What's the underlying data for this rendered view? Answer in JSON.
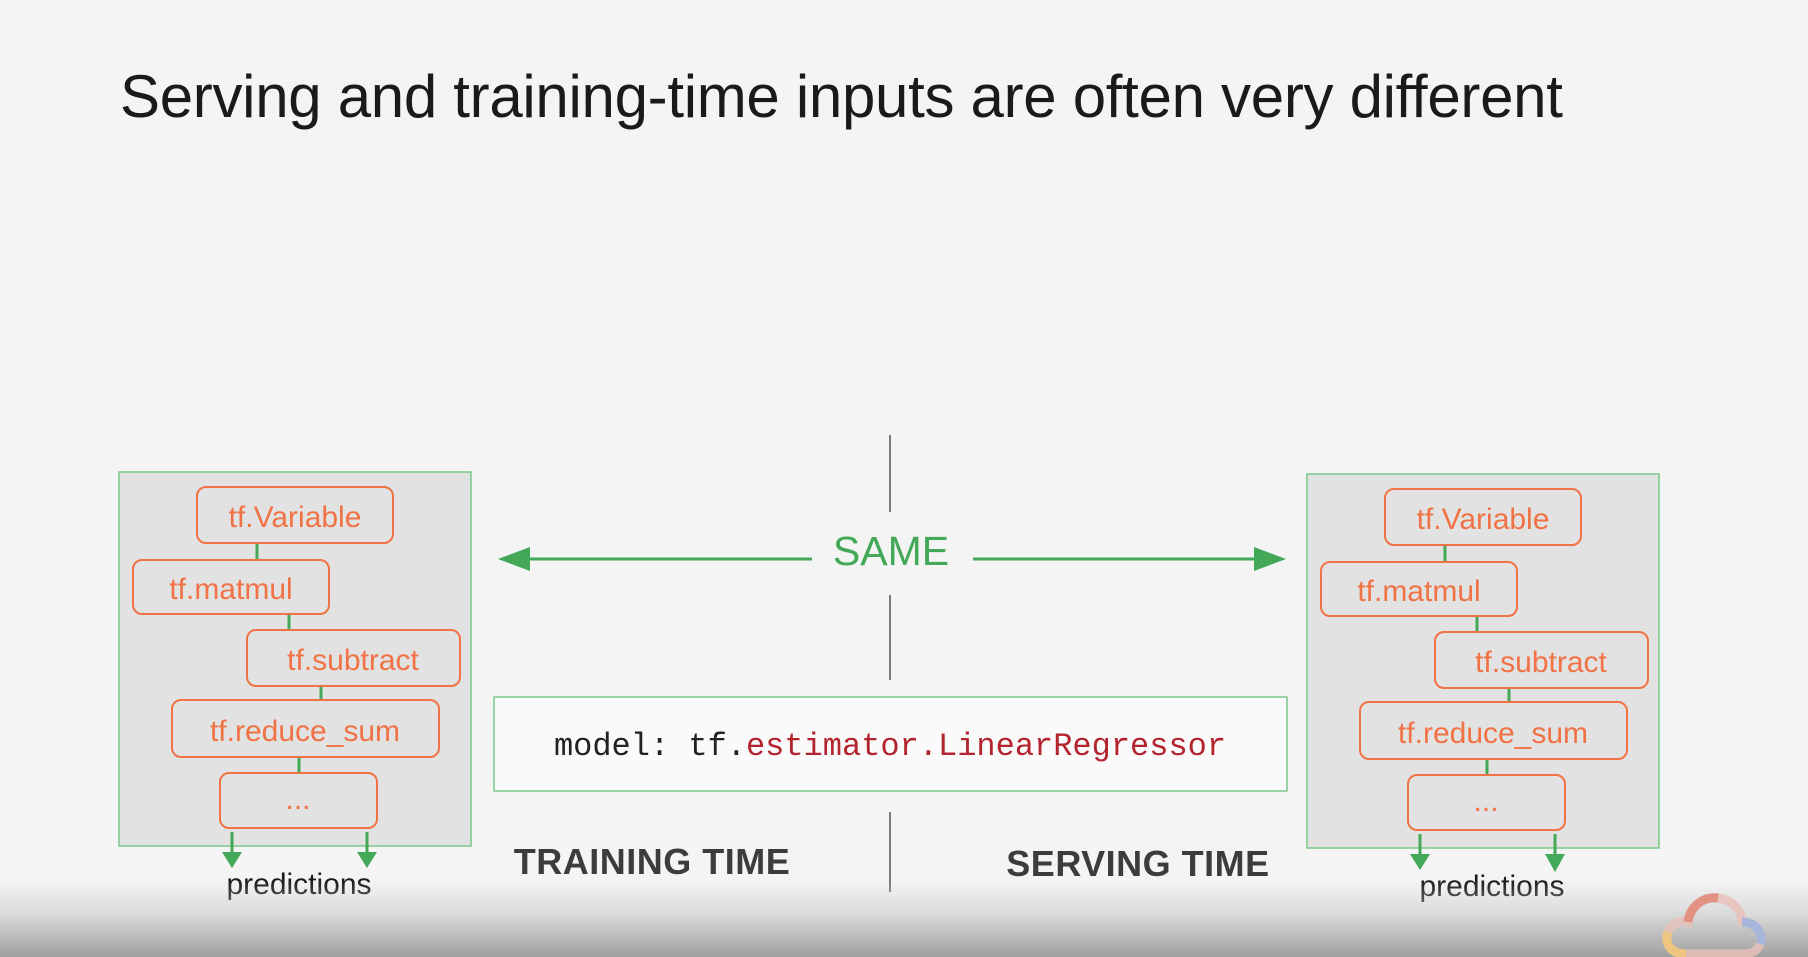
{
  "title": "Serving and training-time inputs are often very different",
  "left_stack": {
    "nodes": [
      "tf.Variable",
      "tf.matmul",
      "tf.subtract",
      "tf.reduce_sum",
      "..."
    ],
    "output_label": "predictions"
  },
  "right_stack": {
    "nodes": [
      "tf.Variable",
      "tf.matmul",
      "tf.subtract",
      "tf.reduce_sum",
      "..."
    ],
    "output_label": "predictions"
  },
  "same_label": "SAME",
  "model": {
    "prefix": "model: tf.",
    "highlight": "estimator.LinearRegressor"
  },
  "training_label": "TRAINING TIME",
  "serving_label": "SERVING TIME",
  "colors": {
    "node_border": "#f07245",
    "green": "#43a857",
    "panel_fill": "#e2e2e2",
    "code_highlight": "#b3242f"
  },
  "logo": "google-cloud-icon"
}
